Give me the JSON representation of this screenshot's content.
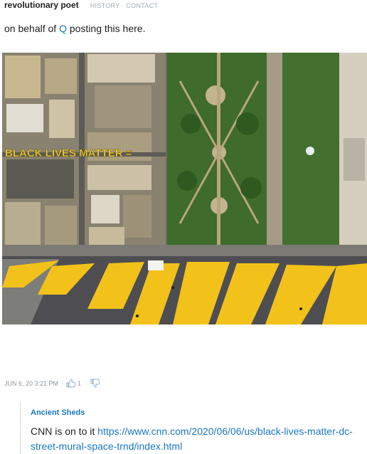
{
  "post": {
    "author": "revolutionary poet",
    "links": [
      "HISTORY",
      "CONTACT"
    ],
    "link_separator": "·",
    "text_prefix": "on behalf of ",
    "mention": "Q",
    "text_suffix": " posting this here.",
    "image_overlay_text": "BLACK LIVES MATTER ="
  },
  "footer": {
    "timestamp": "JUN 6, 20 3:21 PM",
    "separator": "·",
    "likes": "1",
    "like_icon": "thumbs-up-icon",
    "dislike_icon": "thumbs-down-icon"
  },
  "reply": {
    "author": "Ancient Sheds",
    "text": "CNN is on to it ",
    "link": "https://www.cnn.com/2020/06/06/us/black-lives-matter-dc-street-mural-space-trnd/index.html"
  },
  "colors": {
    "link": "#1a78c2",
    "muted": "#a0aab8",
    "mural_yellow": "#f2c21a"
  }
}
